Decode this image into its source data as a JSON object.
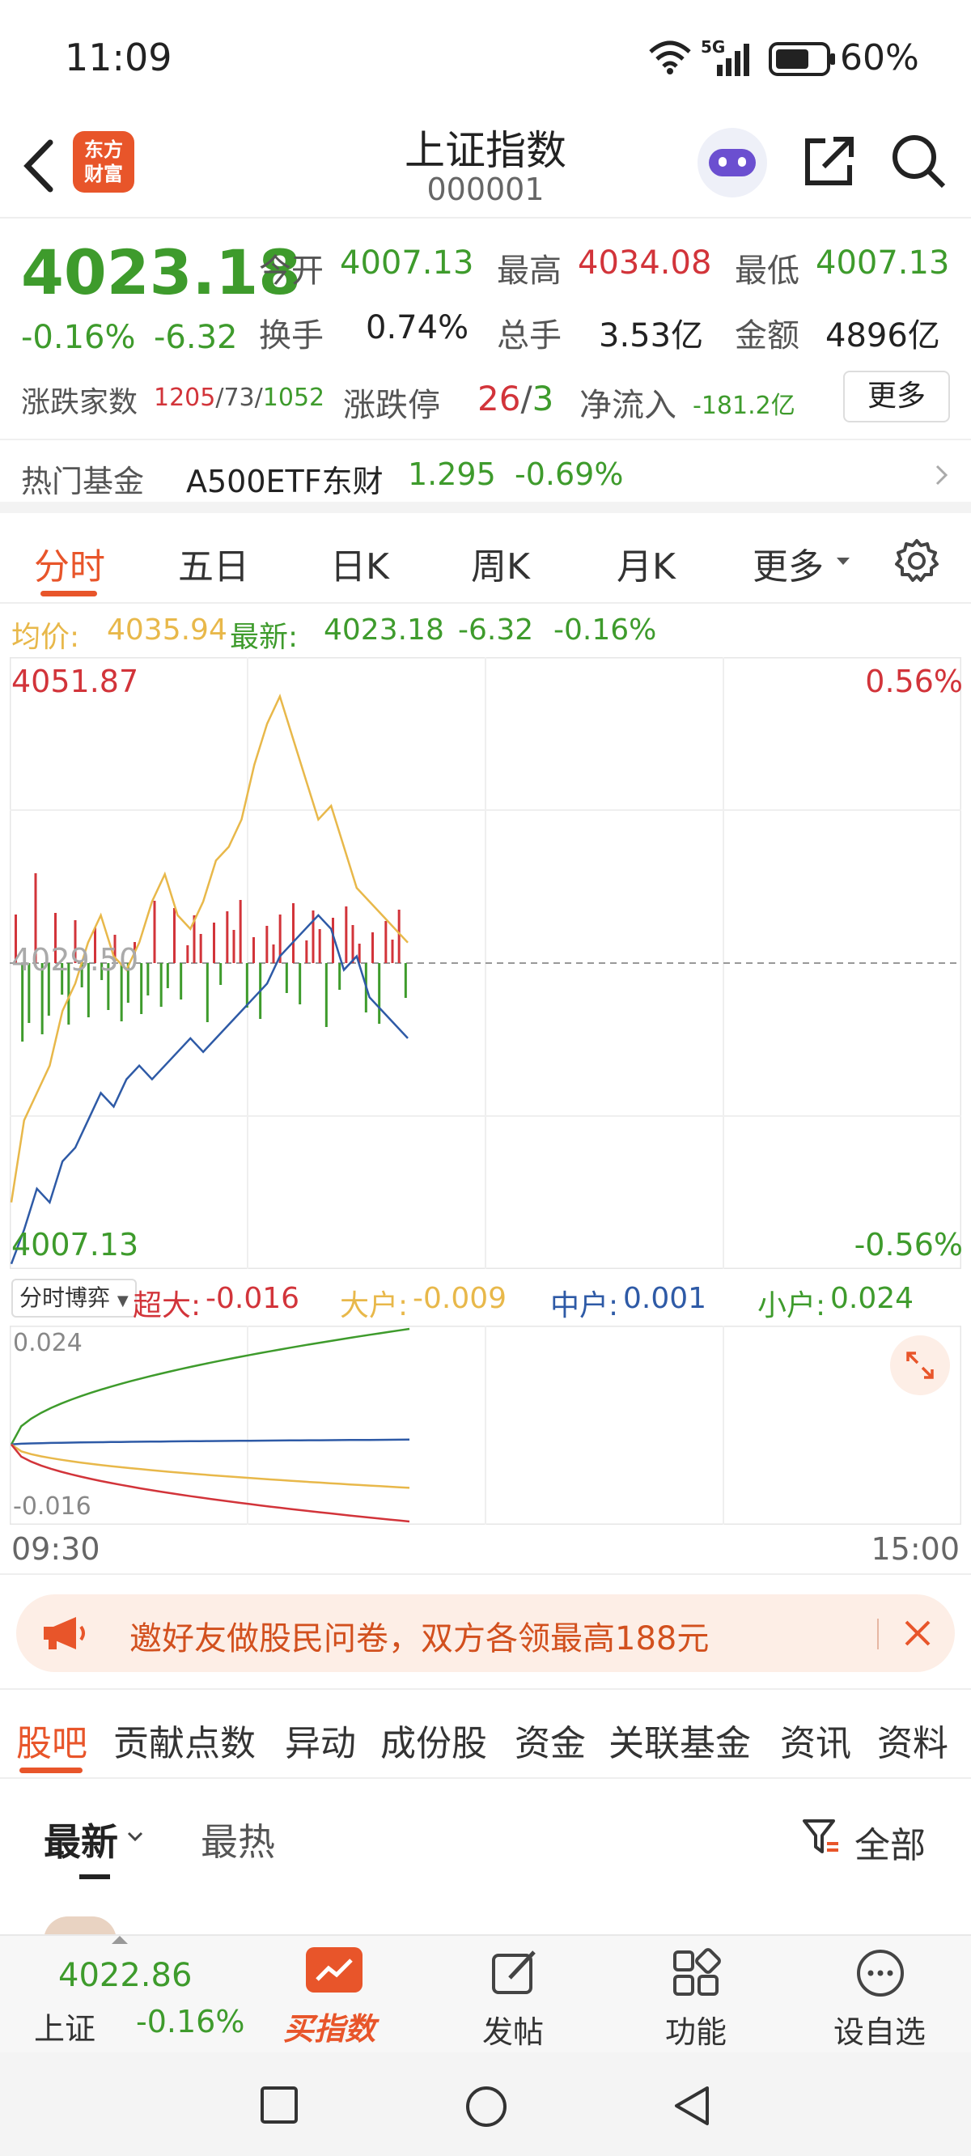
{
  "status_bar": {
    "time": "11:09",
    "network": "5G",
    "battery": "60%"
  },
  "header": {
    "title": "上证指数",
    "code": "000001",
    "app_logo_text": "东方财富"
  },
  "quote": {
    "price": "4023.18",
    "change_pct": "-0.16%",
    "change": "-6.32",
    "open_label": "今开",
    "open": "4007.13",
    "high_label": "最高",
    "high": "4034.08",
    "low_label": "最低",
    "low": "4007.13",
    "turnover_label": "换手",
    "turnover": "0.74%",
    "volume_label": "总手",
    "volume": "3.53亿",
    "amount_label": "金额",
    "amount": "4896亿",
    "breadth_label": "涨跌家数",
    "breadth_up": "1205",
    "breadth_flat": "73",
    "breadth_down": "1052",
    "limit_label": "涨跌停",
    "limit_up": "26",
    "limit_down": "3",
    "netflow_label": "净流入",
    "netflow": "-181.2亿",
    "more_button": "更多"
  },
  "hot_fund": {
    "label": "热门基金",
    "name": "A500ETF东财",
    "price": "1.295",
    "change": "-0.69%"
  },
  "chart_tabs": [
    "分时",
    "五日",
    "日K",
    "周K",
    "月K",
    "更多"
  ],
  "avg_line": {
    "avg_label": "均价:",
    "avg": "4035.94",
    "latest_label": "最新:",
    "latest": "4023.18",
    "change": "-6.32",
    "pct": "-0.16%"
  },
  "chart_data": {
    "type": "line",
    "x_range": [
      "09:30",
      "15:00"
    ],
    "ylim": [
      4007.13,
      4051.87
    ],
    "y_top_label": "4051.87",
    "y_bottom_label": "4007.13",
    "y_mid_label": "4029.50",
    "pct_top": "0.56%",
    "pct_bottom": "-0.56%",
    "series": [
      {
        "color": "#e8b84a",
        "values": [
          4012,
          4018,
          4020,
          4022,
          4026,
          4028,
          4031,
          4033,
          4030,
          4029,
          4031,
          4034,
          4036,
          4033,
          4032,
          4034,
          4037,
          4038,
          4040,
          4044,
          4047,
          4049,
          4046,
          4043,
          4040,
          4041,
          4038,
          4035,
          4034,
          4033,
          4032,
          4031
        ]
      },
      {
        "color": "#2e5aa6",
        "values": [
          4007.5,
          4010,
          4013,
          4012,
          4015,
          4016,
          4018,
          4020,
          4019,
          4021,
          4022,
          4021,
          4022,
          4023,
          4024,
          4023,
          4024,
          4025,
          4026,
          4027,
          4028,
          4030,
          4031,
          4032,
          4033,
          4032,
          4029,
          4030,
          4027,
          4026,
          4025,
          4024
        ]
      }
    ]
  },
  "flow": {
    "selector": "分时博弈",
    "super_label": "超大:",
    "super": "-0.016",
    "large_label": "大户:",
    "large": "-0.009",
    "mid_label": "中户:",
    "mid": "0.001",
    "small_label": "小户:",
    "small": "0.024",
    "top_label": "0.024",
    "bottom_label": "-0.016",
    "colors": {
      "super": "#d2343a",
      "large": "#e8b84a",
      "mid": "#2e5aa6",
      "small": "#3e9b2c"
    }
  },
  "time_axis": {
    "start": "09:30",
    "end": "15:00"
  },
  "banner": {
    "text": "邀好友做股民问卷，双方各领最高188元"
  },
  "bottom_tabs": [
    "股吧",
    "贡献点数",
    "异动",
    "成份股",
    "资金",
    "关联基金",
    "资讯",
    "资料"
  ],
  "sort": {
    "newest": "最新",
    "hottest": "最热",
    "filter": "全部"
  },
  "dock": {
    "index_value": "4022.86",
    "index_name": "上证",
    "index_change": "-0.16%",
    "buy_label": "买指数",
    "post_label": "发帖",
    "func_label": "功能",
    "watch_label": "设自选"
  }
}
